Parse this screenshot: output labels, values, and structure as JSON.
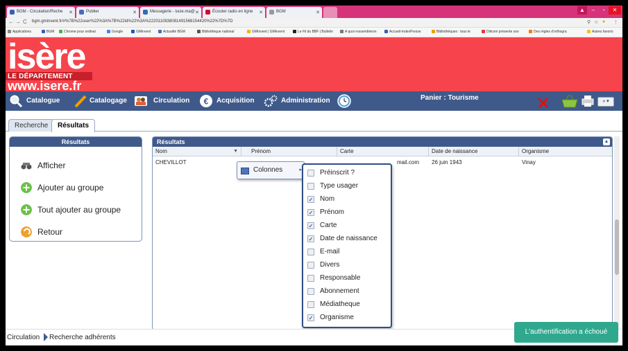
{
  "browser": {
    "tabs": [
      {
        "title": "BGM - Circulation/Reche",
        "color": "#3a5fb0"
      },
      {
        "title": "Publier",
        "color": "#4a6bb8"
      },
      {
        "title": "Messagerie - lucie.ma@",
        "color": "#2d6fb0"
      },
      {
        "title": "Écouter radio en ligne",
        "color": "#d0102a"
      },
      {
        "title": "BGM",
        "color": "#999999"
      }
    ],
    "url": "bgm.gminvent.fr/#%7B%22user%22%3A%7B%22id%22%3A%2220110838081491568154420%22%7D%7D",
    "bookmarks": [
      "Applications",
      "BGM",
      "Chrome pour ordinat",
      "Google",
      "GMinvent",
      "Actualité BGM",
      "Bibliothèque national",
      "GMInvent | GMinvent",
      "Le Fil du BBF | Bulletin",
      "A quoi ressembleron",
      "Accueil-IndexPresse",
      "Bibliothèques : tous le",
      "Dilicom présente son",
      "Des règles d'orthogra",
      "Autres favoris"
    ]
  },
  "banner": {
    "logo_text": "isère",
    "department": "LE DÉPARTEMENT",
    "site": "www.isere.fr"
  },
  "menu": {
    "items": [
      "Catalogue",
      "Catalogage",
      "Circulation",
      "Acquisition",
      "Administration"
    ],
    "panier": "Panier : Tourisme"
  },
  "tabs": {
    "recherche": "Recherche",
    "resultats": "Résultats"
  },
  "left_panel": {
    "title": "Résultats",
    "actions": [
      "Afficher",
      "Ajouter au groupe",
      "Tout ajouter au groupe",
      "Retour"
    ]
  },
  "results": {
    "title": "Résultats",
    "columns": [
      "Nom",
      "Prénom",
      "Carte",
      "Date de naissance",
      "Organisme"
    ],
    "rows": [
      {
        "nom": "CHEVILLOT",
        "carte_fragment": "mail.com",
        "date": "26 juin 1943",
        "organisme": "Vinay"
      }
    ]
  },
  "column_menu": {
    "label": "Colonnes",
    "options": [
      {
        "label": "Préinscrit ?",
        "checked": false
      },
      {
        "label": "Type usager",
        "checked": false
      },
      {
        "label": "Nom",
        "checked": true
      },
      {
        "label": "Prénom",
        "checked": true
      },
      {
        "label": "Carte",
        "checked": true
      },
      {
        "label": "Date de naissance",
        "checked": true
      },
      {
        "label": "E-mail",
        "checked": false
      },
      {
        "label": "Divers",
        "checked": false
      },
      {
        "label": "Responsable",
        "checked": false
      },
      {
        "label": "Abonnement",
        "checked": false
      },
      {
        "label": "Médiatheque",
        "checked": false
      },
      {
        "label": "Organisme",
        "checked": true
      }
    ]
  },
  "footer": {
    "breadcrumb": [
      "Circulation",
      "Recherche adhérents"
    ],
    "toast": "L'authentification a échoué"
  }
}
